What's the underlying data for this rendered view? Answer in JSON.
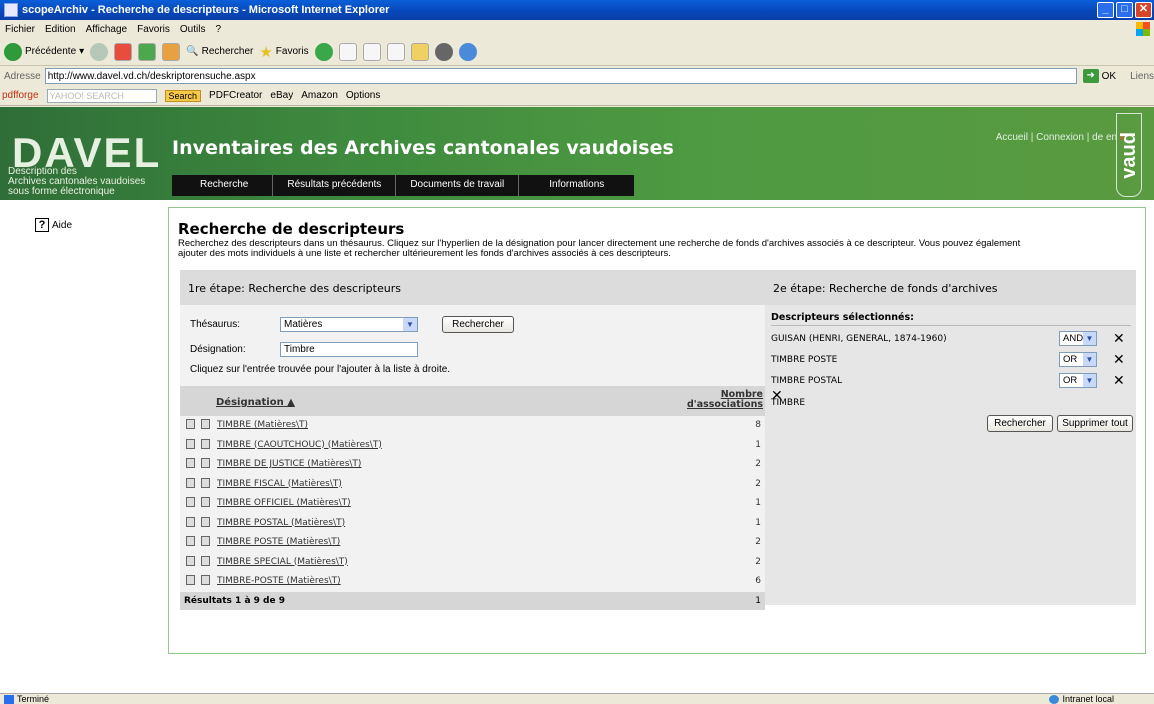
{
  "window": {
    "title": "scopeArchiv - Recherche de descripteurs - Microsoft Internet Explorer"
  },
  "menu": [
    "Fichier",
    "Edition",
    "Affichage",
    "Favoris",
    "Outils",
    "?"
  ],
  "toolbar": {
    "back": "Précédente",
    "search": "Rechercher",
    "favorites": "Favoris"
  },
  "address": {
    "label": "Adresse",
    "url": "http://www.davel.vd.ch/deskriptorensuche.aspx",
    "go": "OK",
    "links": "Liens"
  },
  "yahoo": {
    "pdfforge": "pdfforge",
    "search_placeholder": "YAHOO! SEARCH",
    "search_button": "Search",
    "pdfcreator": "PDFCreator",
    "ebay": "eBay",
    "amazon": "Amazon",
    "options": "Options"
  },
  "banner": {
    "logo": "DAVEL",
    "logo_sub1": "Description des",
    "logo_sub2": "Archives cantonales vaudoises",
    "logo_sub3": "sous forme électronique",
    "title": "Inventaires des Archives cantonales vaudoises",
    "accueil": "Accueil",
    "connexion": "Connexion",
    "lang_de": "de",
    "lang_en": "en",
    "lang_fr": "fr",
    "nav": [
      "Recherche",
      "Résultats précédents",
      "Documents de travail",
      "Informations"
    ],
    "vaud": "vaud"
  },
  "aide": "Aide",
  "main": {
    "title": "Recherche de descripteurs",
    "desc1": "Recherchez des descripteurs dans un thésaurus. Cliquez sur l'hyperlien de la désignation pour lancer directement une recherche de fonds d'archives associés à ce descripteur. Vous pouvez également",
    "desc2": "ajouter des mots individuels à une liste et rechercher ultérieurement les fonds d'archives associés à ces descripteurs."
  },
  "step1": {
    "heading": "1re étape: Recherche des descripteurs",
    "thesaurus_label": "Thésaurus:",
    "thesaurus_value": "Matières",
    "search_button": "Rechercher",
    "designation_label": "Désignation:",
    "designation_value": "Timbre",
    "hint": "Cliquez sur l'entrée trouvée pour l'ajouter à la liste à droite.",
    "col_designation": "Désignation",
    "col_count1": "Nombre",
    "col_count2": "d'associations",
    "rows": [
      {
        "label": "TIMBRE (Matières\\T)",
        "count": "8"
      },
      {
        "label": "TIMBRE (CAOUTCHOUC) (Matières\\T)",
        "count": "1"
      },
      {
        "label": "TIMBRE DE JUSTICE (Matières\\T)",
        "count": "2"
      },
      {
        "label": "TIMBRE FISCAL (Matières\\T)",
        "count": "2"
      },
      {
        "label": "TIMBRE OFFICIEL (Matières\\T)",
        "count": "1"
      },
      {
        "label": "TIMBRE POSTAL (Matières\\T)",
        "count": "1"
      },
      {
        "label": "TIMBRE POSTE (Matières\\T)",
        "count": "2"
      },
      {
        "label": "TIMBRE SPECIAL (Matières\\T)",
        "count": "2"
      },
      {
        "label": "TIMBRE-POSTE (Matières\\T)",
        "count": "6"
      }
    ],
    "footer_left": "Résultats 1 à 9 de 9",
    "footer_right": "1"
  },
  "step2": {
    "heading": "2e étape: Recherche de fonds d'archives",
    "subheading": "Descripteurs sélectionnés:",
    "items": [
      {
        "name": "GUISAN (HENRI, GENERAL, 1874-1960)",
        "op": "AND"
      },
      {
        "name": "TIMBRE POSTE",
        "op": "OR"
      },
      {
        "name": "TIMBRE POSTAL",
        "op": "OR"
      },
      {
        "name": "TIMBRE",
        "op": ""
      }
    ],
    "remove_glyph": "✕",
    "search_button": "Rechercher",
    "clear_button": "Supprimer tout"
  },
  "status": {
    "left": "Terminé",
    "zone": "Intranet local"
  }
}
